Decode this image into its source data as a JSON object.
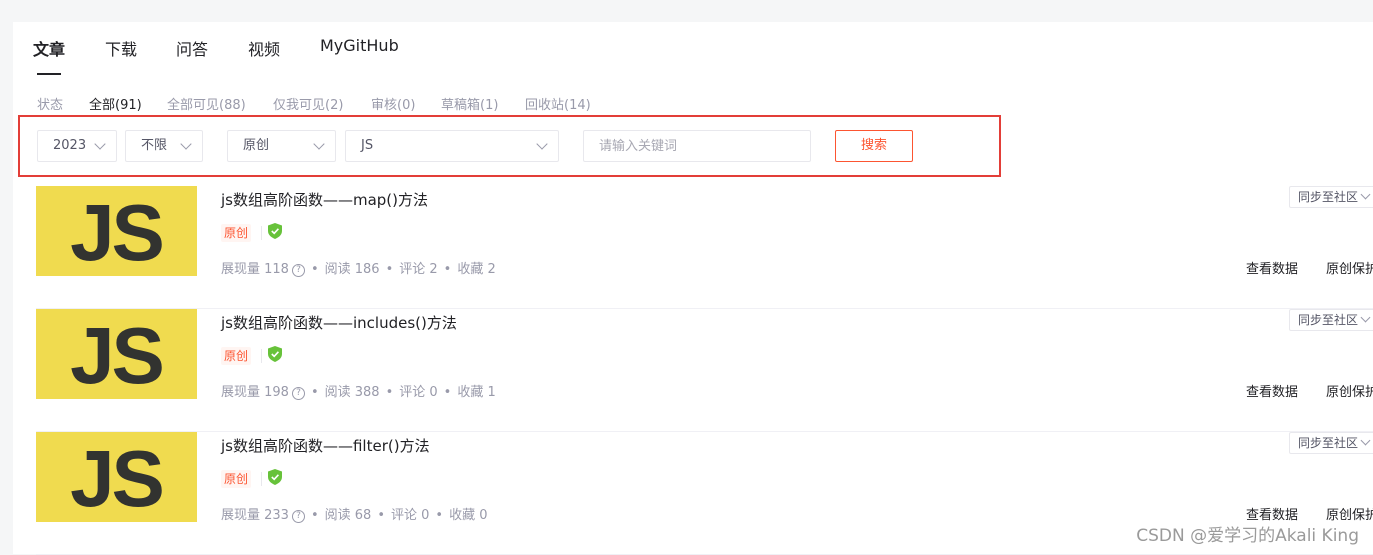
{
  "main_tabs": [
    {
      "label": "文章",
      "active": true
    },
    {
      "label": "下载",
      "active": false
    },
    {
      "label": "问答",
      "active": false
    },
    {
      "label": "视频",
      "active": false
    },
    {
      "label": "MyGitHub",
      "active": false
    }
  ],
  "status_filter": {
    "label": "状态",
    "items": [
      {
        "label": "全部(91)",
        "active": true
      },
      {
        "label": "全部可见(88)",
        "active": false
      },
      {
        "label": "仅我可见(2)",
        "active": false
      },
      {
        "label": "审核(0)",
        "active": false
      },
      {
        "label": "草稿箱(1)",
        "active": false
      },
      {
        "label": "回收站(14)",
        "active": false
      }
    ]
  },
  "filters": {
    "year": "2023",
    "month": "不限",
    "type": "原创",
    "category": "JS",
    "keyword_placeholder": "请输入关键词",
    "keyword_value": "",
    "search_label": "搜索"
  },
  "articles": [
    {
      "thumb_text": "JS",
      "title": "js数组高阶函数——map()方法",
      "tag": "原创",
      "stats": {
        "impressions": "展现量 118",
        "reads": "阅读 186",
        "comments": "评论 2",
        "favorites": "收藏 2"
      },
      "sync_label": "同步至社区",
      "actions": [
        "查看数据",
        "原创保护"
      ]
    },
    {
      "thumb_text": "JS",
      "title": "js数组高阶函数——includes()方法",
      "tag": "原创",
      "stats": {
        "impressions": "展现量 198",
        "reads": "阅读 388",
        "comments": "评论 0",
        "favorites": "收藏 1"
      },
      "sync_label": "同步至社区",
      "actions": [
        "查看数据",
        "原创保护"
      ]
    },
    {
      "thumb_text": "JS",
      "title": "js数组高阶函数——filter()方法",
      "tag": "原创",
      "stats": {
        "impressions": "展现量 233",
        "reads": "阅读 68",
        "comments": "评论 0",
        "favorites": "收藏 0"
      },
      "sync_label": "同步至社区",
      "actions": [
        "查看数据",
        "原创保护"
      ]
    }
  ],
  "watermark": "CSDN @爱学习的Akali King",
  "colors": {
    "accent": "#fc5531",
    "highlight_border": "#e33e38",
    "js_yellow": "#f0db4f",
    "verified_green": "#67c23a"
  }
}
